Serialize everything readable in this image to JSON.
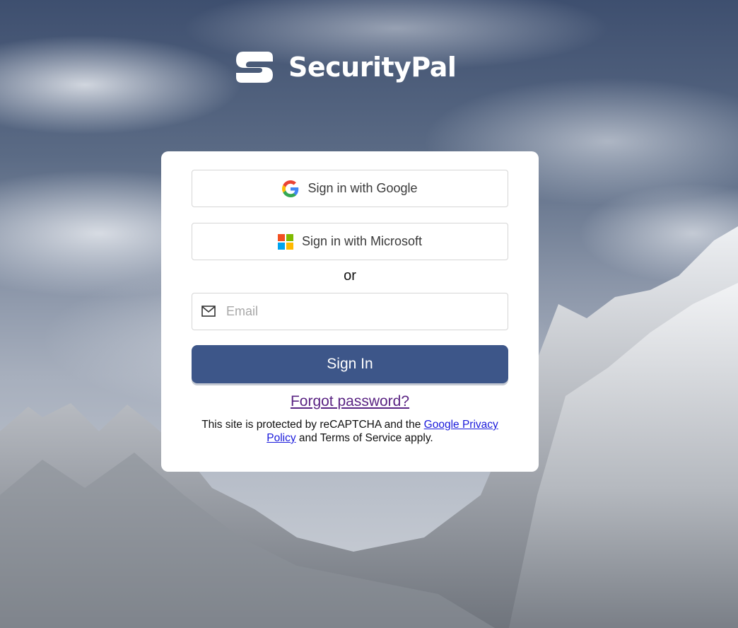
{
  "brand": {
    "name": "SecurityPal",
    "logo_icon": "securitypal-s-mark"
  },
  "auth": {
    "google_button": {
      "label": "Sign in with Google",
      "icon": "google-g-icon"
    },
    "microsoft_button": {
      "label": "Sign in with Microsoft",
      "icon": "microsoft-logo-icon"
    },
    "divider_text": "or",
    "email": {
      "placeholder": "Email",
      "value": "",
      "icon": "mail-icon"
    },
    "signin_button": {
      "label": "Sign In"
    },
    "forgot_link": "Forgot password?"
  },
  "recaptcha": {
    "prefix": "This site is protected by reCAPTCHA and the ",
    "link_google_privacy": "Google Privacy",
    "link_policy": "Policy",
    "suffix": " and Terms of Service apply."
  },
  "colors": {
    "primary_button": "#3d5689",
    "link_visited": "#5a2483",
    "link": "#1a1adb"
  }
}
